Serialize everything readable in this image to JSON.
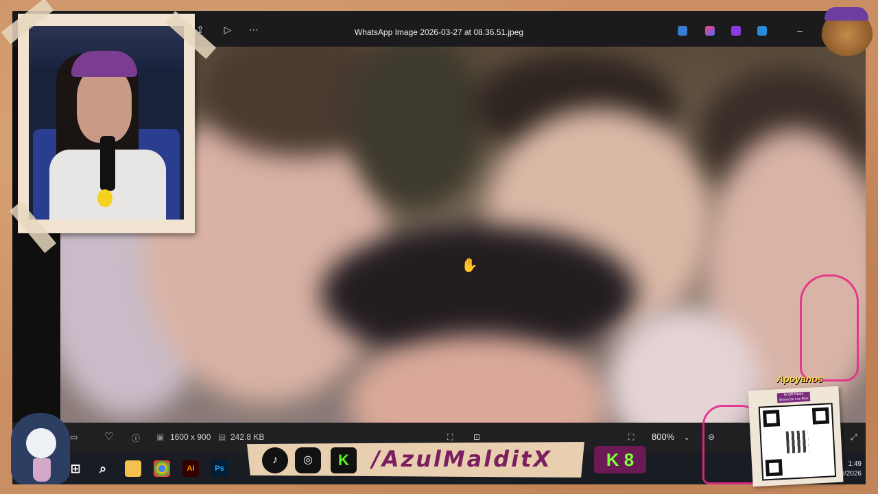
{
  "viewer": {
    "filename": "WhatsApp Image 2026-03-27 at 08.36.51.jpeg",
    "dimensions": "1600 x 900",
    "filesize": "242.8 KB",
    "zoom": "800%"
  },
  "taskbar": {
    "time": "1:49",
    "date": "03/2026",
    "apps": [
      "windows-start",
      "search",
      "file-explorer",
      "chrome",
      "illustrator",
      "photoshop"
    ],
    "illustrator_label": "Ai",
    "photoshop_label": "Ps"
  },
  "overlay": {
    "handle": "/AzulMalditX",
    "k_badge": "K 8",
    "support_title": "Apoyanos",
    "qr_label_line1": "Mi QR Nequi",
    "qr_label_line2": "Simon De Los Rios",
    "kick_letter": "K"
  },
  "colors": {
    "titlebar": "#1b1b1d",
    "taskbar": "#1a1c24",
    "banner_text": "#7b1f5f",
    "k_badge_text": "#7bff3a"
  }
}
